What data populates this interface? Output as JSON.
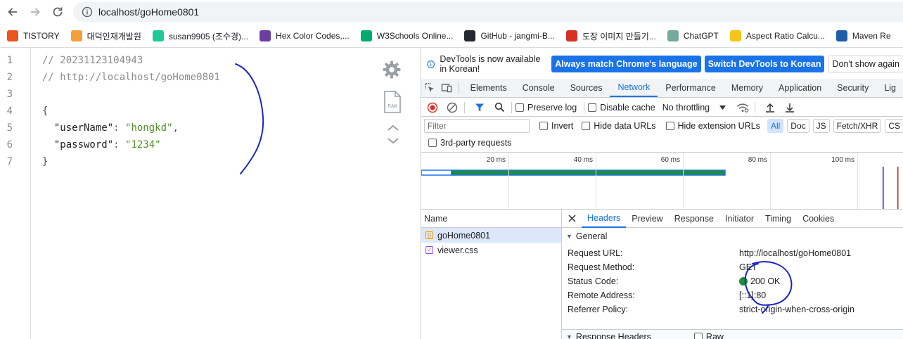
{
  "browser": {
    "url": "localhost/goHome0801",
    "bookmarks": [
      {
        "label": "TISTORY",
        "color": "#eb531f",
        "icon": "tistory-icon"
      },
      {
        "label": "대덕인재개발원",
        "color": "#f4a03a",
        "icon": "bird-icon"
      },
      {
        "label": "susan9905 (조수경)...",
        "color": "#20c997",
        "icon": "velog-icon"
      },
      {
        "label": "Hex Color Codes,...",
        "color": "#6b3fa0",
        "icon": "color-books-icon"
      },
      {
        "label": "W3Schools Online...",
        "color": "#04aa6d",
        "icon": "w3schools-icon"
      },
      {
        "label": "GitHub - jangmi-B...",
        "color": "#24292f",
        "icon": "github-icon"
      },
      {
        "label": "도장 이미지 만들기...",
        "color": "#d93025",
        "icon": "stamp-icon"
      },
      {
        "label": "ChatGPT",
        "color": "#74aa9c",
        "icon": "chatgpt-icon"
      },
      {
        "label": "Aspect Ratio Calcu...",
        "color": "#f5c518",
        "icon": "aspect-ratio-icon"
      },
      {
        "label": "Maven Re",
        "color": "#1f5fa8",
        "icon": "maven-icon"
      }
    ]
  },
  "viewer": {
    "line_numbers": [
      "1",
      "2",
      "3",
      "4",
      "5",
      "6",
      "7"
    ],
    "comment1": "// 20231123104943",
    "comment2": "// http://localhost/goHome0801",
    "brace_open": "{",
    "key1": "\"userName\"",
    "val1": "\"hongkd\"",
    "key2": "\"password\"",
    "val2": "\"1234\"",
    "brace_close": "}",
    "raw_label": "RAW"
  },
  "devtools": {
    "infobar": {
      "message": "DevTools is now available in Korean!",
      "btn_match": "Always match Chrome's language",
      "btn_switch": "Switch DevTools to Korean",
      "btn_dismiss": "Don't show again"
    },
    "tabs": [
      "Elements",
      "Console",
      "Sources",
      "Network",
      "Performance",
      "Memory",
      "Application",
      "Security",
      "Lig"
    ],
    "active_tab": "Network",
    "toolbar": {
      "preserve_log": "Preserve log",
      "disable_cache": "Disable cache",
      "throttling": "No throttling"
    },
    "filter": {
      "placeholder": "Filter",
      "invert": "Invert",
      "hide_data_urls": "Hide data URLs",
      "hide_extension_urls": "Hide extension URLs",
      "types": [
        "All",
        "Doc",
        "JS",
        "Fetch/XHR",
        "CS"
      ]
    },
    "third_party": "3rd-party requests",
    "timeline_ticks": [
      "20 ms",
      "40 ms",
      "60 ms",
      "80 ms",
      "100 ms"
    ],
    "request_list": {
      "header": "Name",
      "rows": [
        "goHome0801",
        "viewer.css"
      ]
    },
    "details": {
      "tabs": [
        "Headers",
        "Preview",
        "Response",
        "Initiator",
        "Timing",
        "Cookies"
      ],
      "general_title": "General",
      "rows": [
        {
          "k": "Request URL:",
          "v": "http://localhost/goHome0801"
        },
        {
          "k": "Request Method:",
          "v": "GET"
        },
        {
          "k": "Status Code:",
          "v": "200 OK"
        },
        {
          "k": "Remote Address:",
          "v": "[::1]:80"
        },
        {
          "k": "Referrer Policy:",
          "v": "strict-origin-when-cross-origin"
        }
      ],
      "response_headers_title": "Response Headers",
      "raw_label": "Raw"
    }
  },
  "colors": {
    "accent": "#1a73e8",
    "string_green": "#4f8f24",
    "annotation_ink": "#1c23c9",
    "status_green": "#1e8e3e"
  }
}
